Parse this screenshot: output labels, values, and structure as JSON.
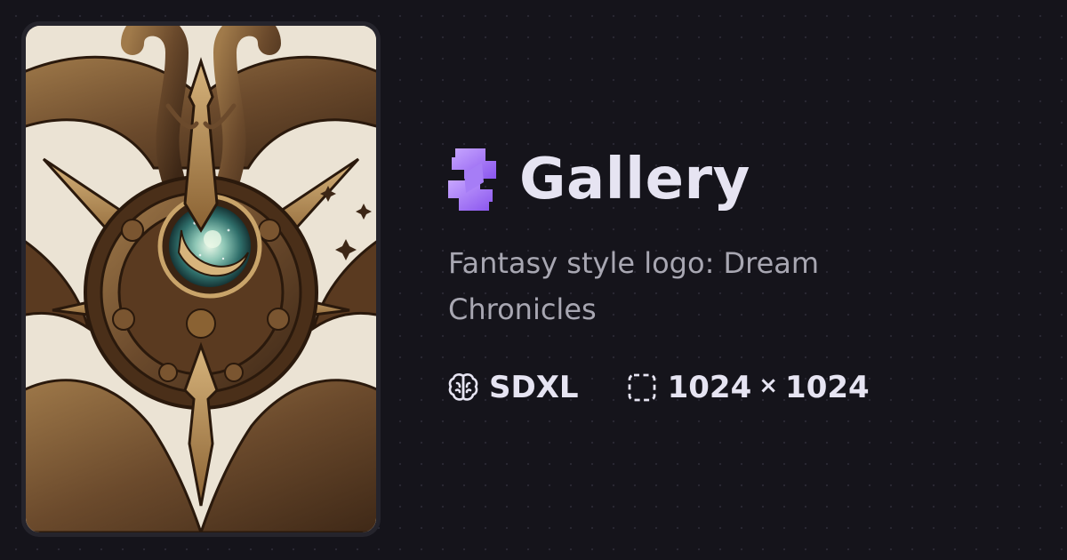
{
  "header": {
    "logo_icon": "invoke-logo-icon",
    "title": "Gallery"
  },
  "image": {
    "description_icon": "fantasy-logo-artwork"
  },
  "prompt": "Fantasy style logo: Dream Chronicles",
  "meta": {
    "model_icon": "brain-icon",
    "model": "SDXL",
    "size_icon": "dashed-frame-icon",
    "width": "1024",
    "times": "×",
    "height": "1024"
  },
  "colors": {
    "background": "#15141b",
    "accent": "#9b6cf3",
    "title": "#e6e4f2",
    "muted": "#a8a7b2"
  }
}
